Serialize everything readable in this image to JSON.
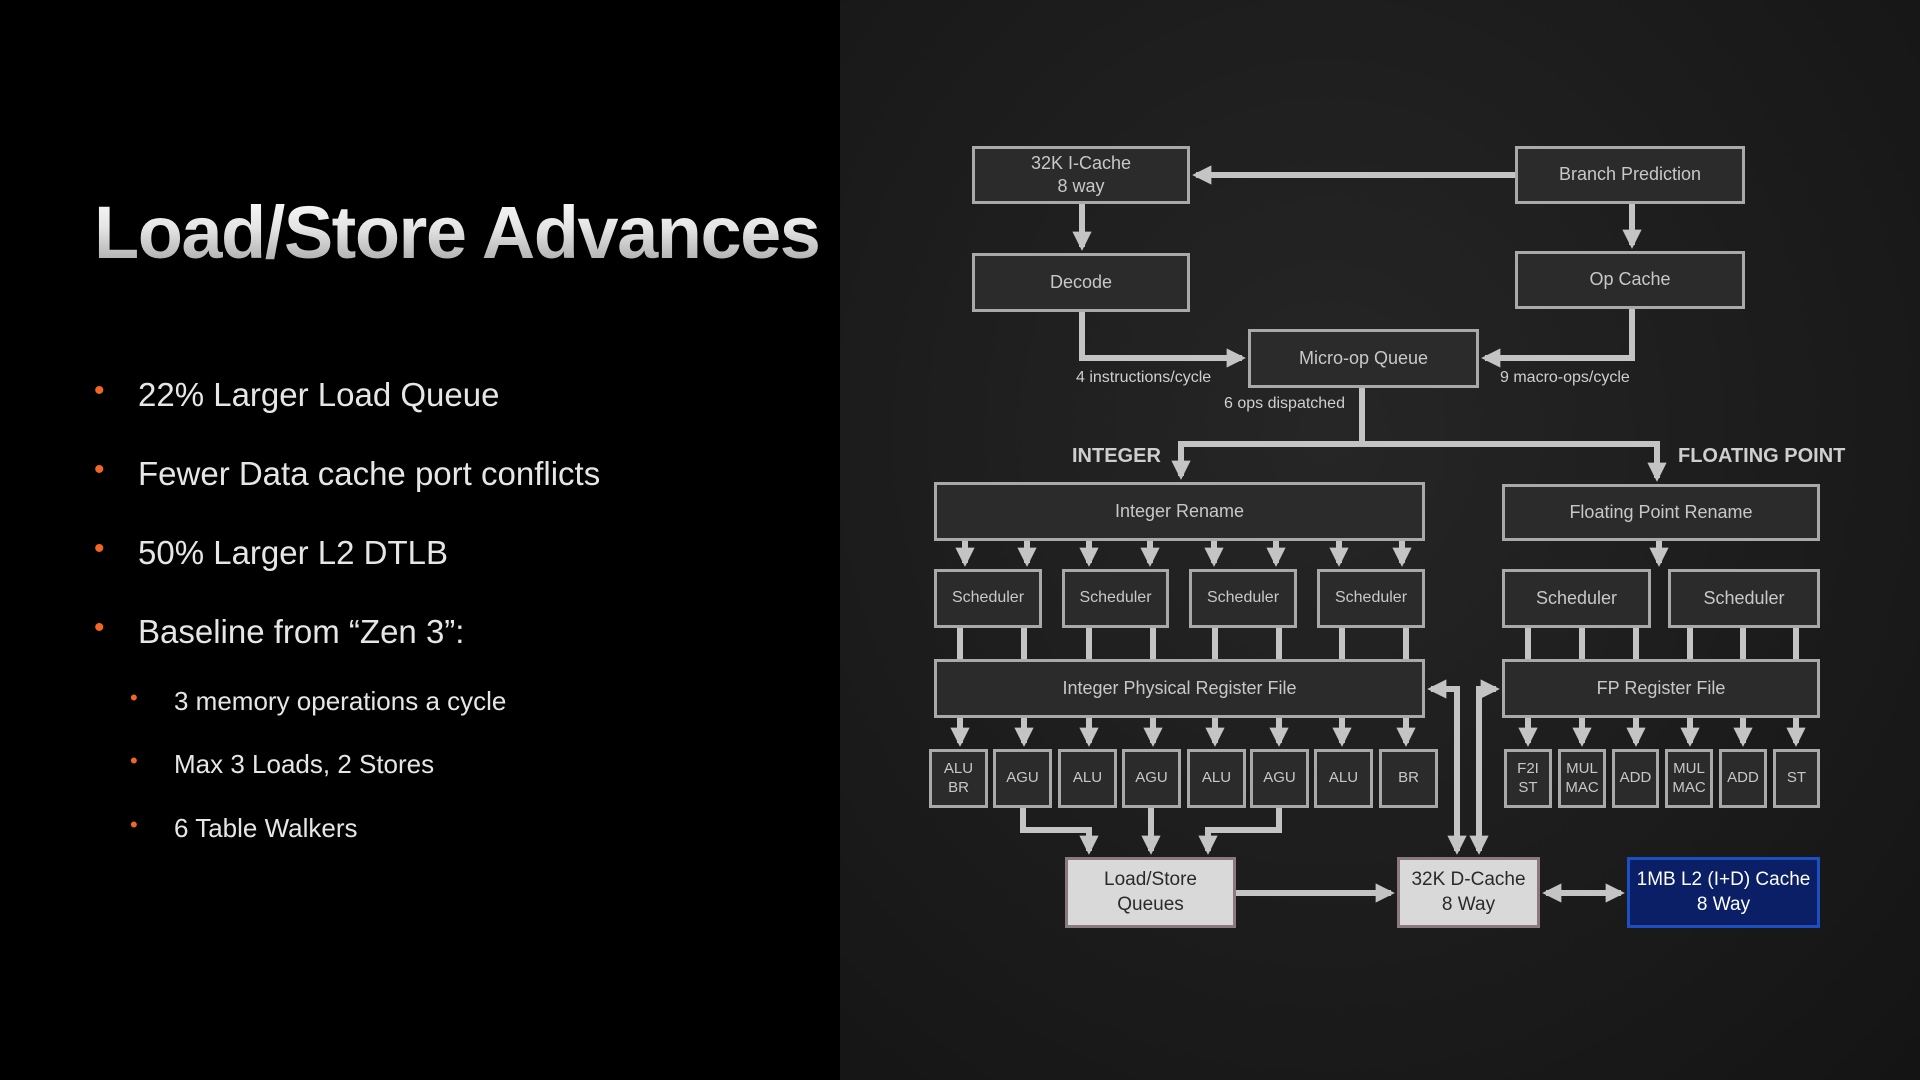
{
  "slide": {
    "title": "Load/Store Advances",
    "bullets": [
      {
        "text": "22% Larger Load Queue",
        "level": 1
      },
      {
        "text": "Fewer Data cache port conflicts",
        "level": 1
      },
      {
        "text": "50% Larger L2 DTLB",
        "level": 1
      },
      {
        "text": "Baseline from “Zen 3”:",
        "level": 1
      },
      {
        "text": "3 memory operations a cycle",
        "level": 2
      },
      {
        "text": "Max 3 Loads, 2 Stores",
        "level": 2
      },
      {
        "text": "6 Table Walkers",
        "level": 2
      }
    ],
    "bullet_glyph": "•",
    "accent_color": "#f26522"
  },
  "diagram": {
    "frontend": {
      "icache": "32K I-Cache\n8 way",
      "branch_prediction": "Branch Prediction",
      "decode": "Decode",
      "op_cache": "Op Cache",
      "micro_op_queue": "Micro-op Queue"
    },
    "labels": {
      "decode_rate": "4 instructions/cycle",
      "opcache_rate": "9 macro-ops/cycle",
      "dispatch": "6 ops dispatched",
      "integer": "INTEGER",
      "floating_point": "FLOATING POINT"
    },
    "integer": {
      "rename": "Integer Rename",
      "schedulers": [
        "Scheduler",
        "Scheduler",
        "Scheduler",
        "Scheduler"
      ],
      "register_file": "Integer Physical Register File",
      "units": [
        "ALU\nBR",
        "AGU",
        "ALU",
        "AGU",
        "ALU",
        "AGU",
        "ALU",
        "BR"
      ]
    },
    "fp": {
      "rename": "Floating Point Rename",
      "schedulers": [
        "Scheduler",
        "Scheduler"
      ],
      "register_file": "FP Register File",
      "units": [
        "F2I\nST",
        "MUL\nMAC",
        "ADD",
        "MUL\nMAC",
        "ADD",
        "ST"
      ]
    },
    "memory": {
      "load_store_queues": "Load/Store\nQueues",
      "dcache": "32K D-Cache\n8 Way",
      "l2": "1MB L2 (I+D) Cache\n8 Way"
    },
    "colors": {
      "box_fill": "#2b2b2b",
      "box_border": "#a9a9a9",
      "connector": "#c4c4c4",
      "memory_box": "#d9d9d9",
      "l2_box": "#0a1f66",
      "l2_border": "#1e4fc2"
    }
  }
}
